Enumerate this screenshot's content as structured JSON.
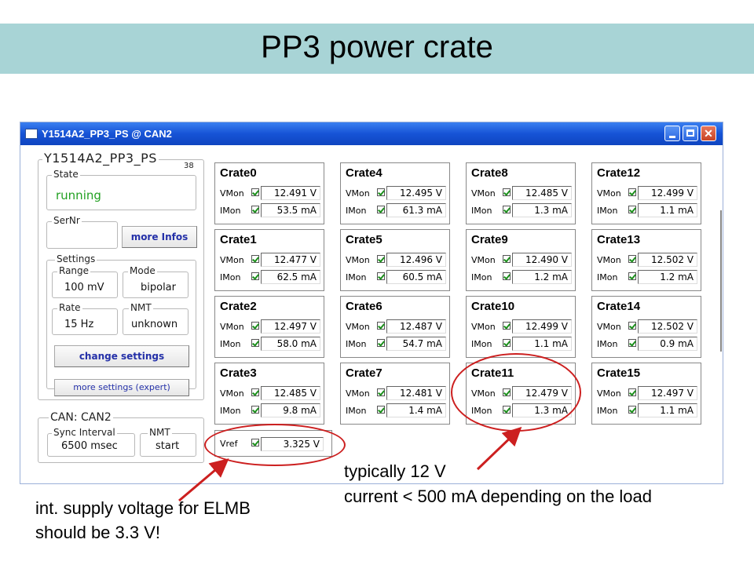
{
  "slide": {
    "title": "PP3 power crate",
    "note_right_line1": "typically 12 V",
    "note_right_line2": "current < 500 mA depending on the load",
    "note_left_line1": "int. supply voltage for ELMB",
    "note_left_line2": "should be 3.3 V!"
  },
  "window": {
    "title": "Y1514A2_PP3_PS @ CAN2",
    "controls": {
      "minimize": "minimize",
      "maximize": "maximize",
      "close": "✕"
    }
  },
  "device": {
    "name": "Y1514A2_PP3_PS",
    "node_id": "38",
    "state_label": "State",
    "state_value": "running",
    "sernr_label": "SerNr",
    "sernr_value": "",
    "more_infos_label": "more Infos",
    "settings_label": "Settings",
    "range_label": "Range",
    "range_value": "100 mV",
    "mode_label": "Mode",
    "mode_value": "bipolar",
    "rate_label": "Rate",
    "rate_value": "15 Hz",
    "nmt_label": "NMT",
    "nmt_value": "unknown",
    "change_settings_label": "change settings",
    "more_settings_label": "more settings (expert)"
  },
  "can": {
    "title": "CAN: CAN2",
    "sync_label": "Sync Interval",
    "sync_value": "6500 msec",
    "nmt_label": "NMT",
    "nmt_value": "start"
  },
  "labels": {
    "vmon": "VMon",
    "imon": "IMon",
    "vref": "Vref"
  },
  "vref_value": "3.325 V",
  "crates": [
    {
      "name": "Crate0",
      "vmon": "12.491 V",
      "imon": "53.5 mA"
    },
    {
      "name": "Crate1",
      "vmon": "12.477 V",
      "imon": "62.5 mA"
    },
    {
      "name": "Crate2",
      "vmon": "12.497 V",
      "imon": "58.0 mA"
    },
    {
      "name": "Crate3",
      "vmon": "12.485 V",
      "imon": "9.8 mA"
    },
    {
      "name": "Crate4",
      "vmon": "12.495 V",
      "imon": "61.3 mA"
    },
    {
      "name": "Crate5",
      "vmon": "12.496 V",
      "imon": "60.5 mA"
    },
    {
      "name": "Crate6",
      "vmon": "12.487 V",
      "imon": "54.7 mA"
    },
    {
      "name": "Crate7",
      "vmon": "12.481 V",
      "imon": "1.4 mA"
    },
    {
      "name": "Crate8",
      "vmon": "12.485 V",
      "imon": "1.3 mA"
    },
    {
      "name": "Crate9",
      "vmon": "12.490 V",
      "imon": "1.2 mA"
    },
    {
      "name": "Crate10",
      "vmon": "12.499 V",
      "imon": "1.1 mA"
    },
    {
      "name": "Crate11",
      "vmon": "12.479 V",
      "imon": "1.3 mA"
    },
    {
      "name": "Crate12",
      "vmon": "12.499 V",
      "imon": "1.1 mA"
    },
    {
      "name": "Crate13",
      "vmon": "12.502 V",
      "imon": "1.2 mA"
    },
    {
      "name": "Crate14",
      "vmon": "12.502 V",
      "imon": "0.9 mA"
    },
    {
      "name": "Crate15",
      "vmon": "12.497 V",
      "imon": "1.1 mA"
    }
  ]
}
